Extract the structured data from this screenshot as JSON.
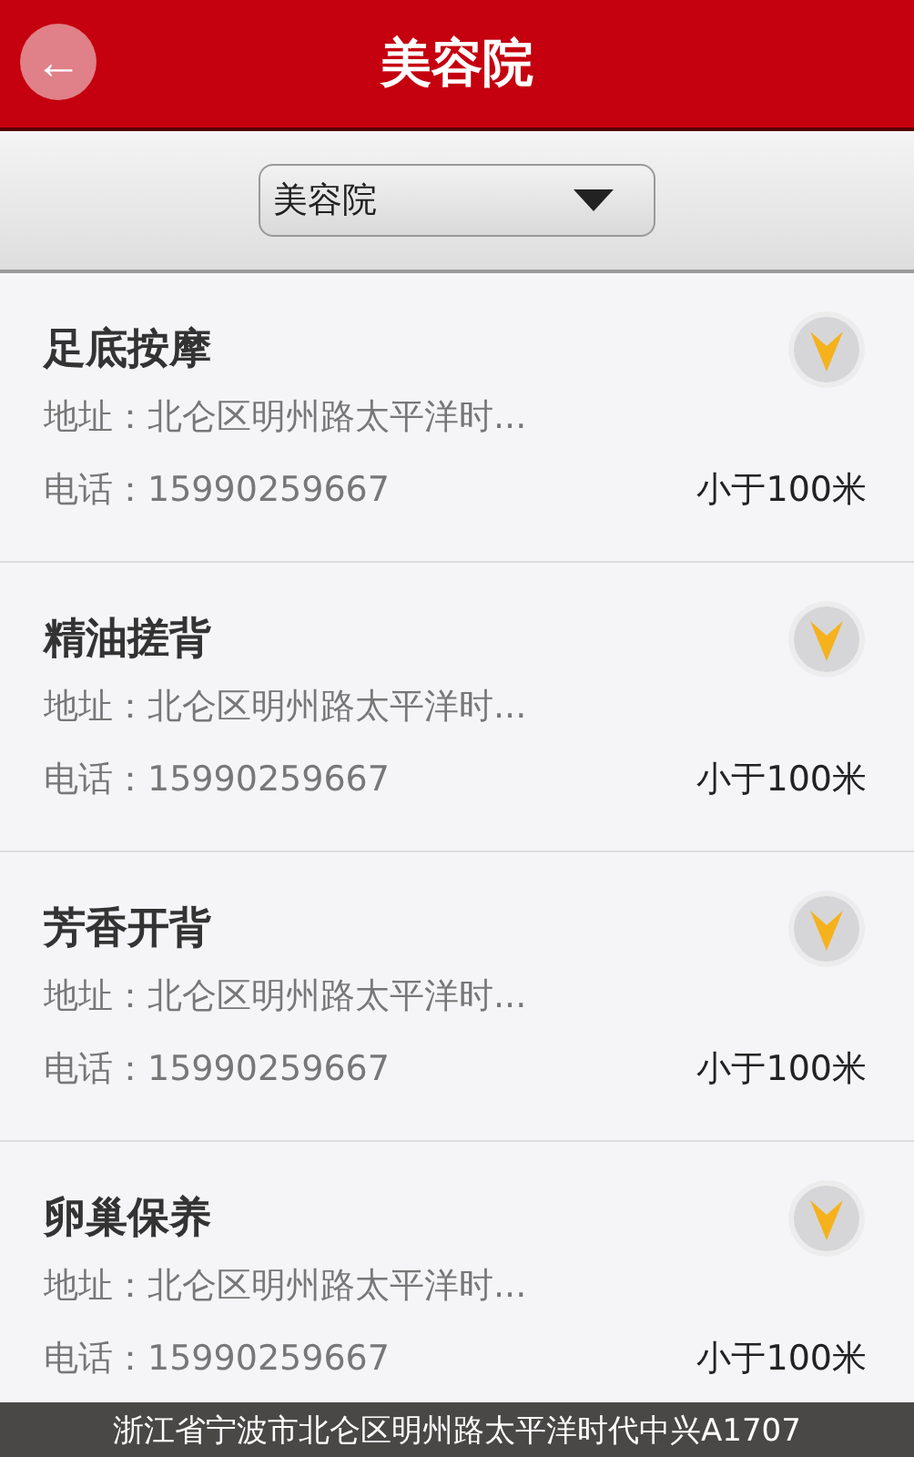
{
  "header": {
    "title": "美容院",
    "back_icon": "←"
  },
  "filter": {
    "value": "美容院"
  },
  "items": [
    {
      "name": "足底按摩",
      "address": "地址：北仑区明州路太平洋时...",
      "phone": "电话：15990259667",
      "distance": "小于100米"
    },
    {
      "name": "精油搓背",
      "address": "地址：北仑区明州路太平洋时...",
      "phone": "电话：15990259667",
      "distance": "小于100米"
    },
    {
      "name": "芳香开背",
      "address": "地址：北仑区明州路太平洋时...",
      "phone": "电话：15990259667",
      "distance": "小于100米"
    },
    {
      "name": "卵巢保养",
      "address": "地址：北仑区明州路太平洋时...",
      "phone": "电话：15990259667",
      "distance": "小于100米"
    }
  ],
  "footer": {
    "text": "浙江省宁波市北仑区明州路太平洋时代中兴A1707"
  }
}
